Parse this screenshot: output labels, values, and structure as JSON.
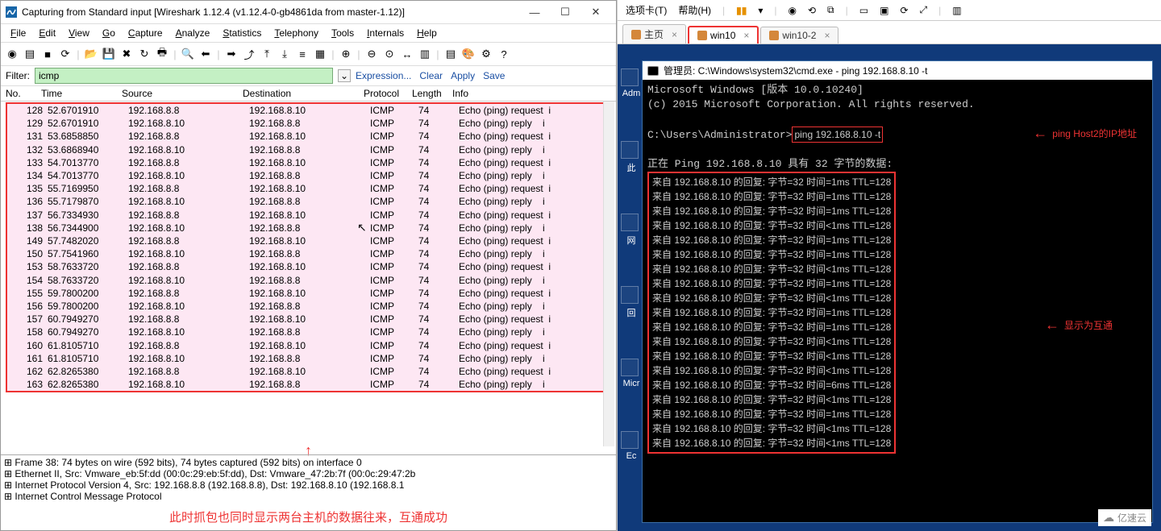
{
  "wireshark": {
    "title": "Capturing from Standard input   [Wireshark 1.12.4  (v1.12.4-0-gb4861da from master-1.12)]",
    "menu": [
      "File",
      "Edit",
      "View",
      "Go",
      "Capture",
      "Analyze",
      "Statistics",
      "Telephony",
      "Tools",
      "Internals",
      "Help"
    ],
    "toolbar_icons": [
      "record-icon",
      "list-icon",
      "stop-icon",
      "reload-icon",
      "open-icon",
      "save-icon",
      "close-icon",
      "restart-icon",
      "print-icon",
      "find-icon",
      "back-icon",
      "forward-icon",
      "jump-icon",
      "top-icon",
      "bottom-icon",
      "autoscroll-icon",
      "colorize-icon",
      "zoom-in-icon",
      "zoom-out-icon",
      "zoom-fit-icon",
      "resize-icon",
      "capture-filter-icon",
      "display-filter-icon",
      "color-rules-icon",
      "prefs-icon",
      "help-icon"
    ],
    "filter": {
      "label": "Filter:",
      "value": "icmp",
      "links": [
        "Expression...",
        "Clear",
        "Apply",
        "Save"
      ]
    },
    "columns": [
      "No.",
      "Time",
      "Source",
      "Destination",
      "Protocol",
      "Length",
      "Info"
    ],
    "rows": [
      {
        "no": "128",
        "time": "52.6701910",
        "src": "192.168.8.8",
        "dst": "192.168.8.10",
        "proto": "ICMP",
        "len": "74",
        "info": "Echo (ping) request  i"
      },
      {
        "no": "129",
        "time": "52.6701910",
        "src": "192.168.8.10",
        "dst": "192.168.8.8",
        "proto": "ICMP",
        "len": "74",
        "info": "Echo (ping) reply    i"
      },
      {
        "no": "131",
        "time": "53.6858850",
        "src": "192.168.8.8",
        "dst": "192.168.8.10",
        "proto": "ICMP",
        "len": "74",
        "info": "Echo (ping) request  i"
      },
      {
        "no": "132",
        "time": "53.6868940",
        "src": "192.168.8.10",
        "dst": "192.168.8.8",
        "proto": "ICMP",
        "len": "74",
        "info": "Echo (ping) reply    i"
      },
      {
        "no": "133",
        "time": "54.7013770",
        "src": "192.168.8.8",
        "dst": "192.168.8.10",
        "proto": "ICMP",
        "len": "74",
        "info": "Echo (ping) request  i"
      },
      {
        "no": "134",
        "time": "54.7013770",
        "src": "192.168.8.10",
        "dst": "192.168.8.8",
        "proto": "ICMP",
        "len": "74",
        "info": "Echo (ping) reply    i"
      },
      {
        "no": "135",
        "time": "55.7169950",
        "src": "192.168.8.8",
        "dst": "192.168.8.10",
        "proto": "ICMP",
        "len": "74",
        "info": "Echo (ping) request  i"
      },
      {
        "no": "136",
        "time": "55.7179870",
        "src": "192.168.8.10",
        "dst": "192.168.8.8",
        "proto": "ICMP",
        "len": "74",
        "info": "Echo (ping) reply    i"
      },
      {
        "no": "137",
        "time": "56.7334930",
        "src": "192.168.8.8",
        "dst": "192.168.8.10",
        "proto": "ICMP",
        "len": "74",
        "info": "Echo (ping) request  i"
      },
      {
        "no": "138",
        "time": "56.7344900",
        "src": "192.168.8.10",
        "dst": "192.168.8.8",
        "proto": "ICMP",
        "len": "74",
        "info": "Echo (ping) reply    i"
      },
      {
        "no": "149",
        "time": "57.7482020",
        "src": "192.168.8.8",
        "dst": "192.168.8.10",
        "proto": "ICMP",
        "len": "74",
        "info": "Echo (ping) request  i"
      },
      {
        "no": "150",
        "time": "57.7541960",
        "src": "192.168.8.10",
        "dst": "192.168.8.8",
        "proto": "ICMP",
        "len": "74",
        "info": "Echo (ping) reply    i"
      },
      {
        "no": "153",
        "time": "58.7633720",
        "src": "192.168.8.8",
        "dst": "192.168.8.10",
        "proto": "ICMP",
        "len": "74",
        "info": "Echo (ping) request  i"
      },
      {
        "no": "154",
        "time": "58.7633720",
        "src": "192.168.8.10",
        "dst": "192.168.8.8",
        "proto": "ICMP",
        "len": "74",
        "info": "Echo (ping) reply    i"
      },
      {
        "no": "155",
        "time": "59.7800200",
        "src": "192.168.8.8",
        "dst": "192.168.8.10",
        "proto": "ICMP",
        "len": "74",
        "info": "Echo (ping) request  i"
      },
      {
        "no": "156",
        "time": "59.7800200",
        "src": "192.168.8.10",
        "dst": "192.168.8.8",
        "proto": "ICMP",
        "len": "74",
        "info": "Echo (ping) reply    i"
      },
      {
        "no": "157",
        "time": "60.7949270",
        "src": "192.168.8.8",
        "dst": "192.168.8.10",
        "proto": "ICMP",
        "len": "74",
        "info": "Echo (ping) request  i"
      },
      {
        "no": "158",
        "time": "60.7949270",
        "src": "192.168.8.10",
        "dst": "192.168.8.8",
        "proto": "ICMP",
        "len": "74",
        "info": "Echo (ping) reply    i"
      },
      {
        "no": "160",
        "time": "61.8105710",
        "src": "192.168.8.8",
        "dst": "192.168.8.10",
        "proto": "ICMP",
        "len": "74",
        "info": "Echo (ping) request  i"
      },
      {
        "no": "161",
        "time": "61.8105710",
        "src": "192.168.8.10",
        "dst": "192.168.8.8",
        "proto": "ICMP",
        "len": "74",
        "info": "Echo (ping) reply    i"
      },
      {
        "no": "162",
        "time": "62.8265380",
        "src": "192.168.8.8",
        "dst": "192.168.8.10",
        "proto": "ICMP",
        "len": "74",
        "info": "Echo (ping) request  i"
      },
      {
        "no": "163",
        "time": "62.8265380",
        "src": "192.168.8.10",
        "dst": "192.168.8.8",
        "proto": "ICMP",
        "len": "74",
        "info": "Echo (ping) reply    i"
      }
    ],
    "tree": [
      "⊞ Frame 38: 74 bytes on wire (592 bits), 74 bytes captured (592 bits) on interface 0",
      "⊞ Ethernet II, Src: Vmware_eb:5f:dd (00:0c:29:eb:5f:dd), Dst: Vmware_47:2b:7f (00:0c:29:47:2b",
      "⊞ Internet Protocol Version 4, Src: 192.168.8.8 (192.168.8.8), Dst: 192.168.8.10 (192.168.8.1",
      "⊞ Internet Control Message Protocol"
    ],
    "arrow": "↑",
    "caption": "此时抓包也同时显示两台主机的数据往来，互通成功"
  },
  "vm": {
    "toolbar": {
      "tabs": "选项卡(T)",
      "help": "帮助(H)",
      "icons": [
        "pause-icon",
        "play-icon",
        "sep",
        "snapshot-icon",
        "revert-icon",
        "manage-icon",
        "sep",
        "fullscreen-icon",
        "unity-icon",
        "cycle-icon",
        "fit-icon",
        "sep",
        "console-icon"
      ]
    },
    "tabs": [
      {
        "label": "主页",
        "active": false,
        "icon": "home-icon"
      },
      {
        "label": "win10",
        "active": true,
        "icon": "vm-icon"
      },
      {
        "label": "win10-2",
        "active": false,
        "icon": "vm-icon"
      }
    ],
    "cmd": {
      "title": "管理员: C:\\Windows\\system32\\cmd.exe - ping  192.168.8.10 -t",
      "header1": "Microsoft Windows [版本 10.0.10240]",
      "header2": "(c) 2015 Microsoft Corporation. All rights reserved.",
      "prompt": "C:\\Users\\Administrator>",
      "pingcmd": "ping 192.168.8.10 -t",
      "pinging": "正在 Ping 192.168.8.10 具有 32 字节的数据:",
      "replies": [
        "来自 192.168.8.10 的回复: 字节=32 时间=1ms TTL=128",
        "来自 192.168.8.10 的回复: 字节=32 时间=1ms TTL=128",
        "来自 192.168.8.10 的回复: 字节=32 时间=1ms TTL=128",
        "来自 192.168.8.10 的回复: 字节=32 时间<1ms TTL=128",
        "来自 192.168.8.10 的回复: 字节=32 时间=1ms TTL=128",
        "来自 192.168.8.10 的回复: 字节=32 时间=1ms TTL=128",
        "来自 192.168.8.10 的回复: 字节=32 时间<1ms TTL=128",
        "来自 192.168.8.10 的回复: 字节=32 时间=1ms TTL=128",
        "来自 192.168.8.10 的回复: 字节=32 时间<1ms TTL=128",
        "来自 192.168.8.10 的回复: 字节=32 时间=1ms TTL=128",
        "来自 192.168.8.10 的回复: 字节=32 时间=1ms TTL=128",
        "来自 192.168.8.10 的回复: 字节=32 时间<1ms TTL=128",
        "来自 192.168.8.10 的回复: 字节=32 时间<1ms TTL=128",
        "来自 192.168.8.10 的回复: 字节=32 时间<1ms TTL=128",
        "来自 192.168.8.10 的回复: 字节=32 时间=6ms TTL=128",
        "来自 192.168.8.10 的回复: 字节=32 时间<1ms TTL=128",
        "来自 192.168.8.10 的回复: 字节=32 时间=1ms TTL=128",
        "来自 192.168.8.10 的回复: 字节=32 时间<1ms TTL=128",
        "来自 192.168.8.10 的回复: 字节=32 时间<1ms TTL=128"
      ]
    },
    "annot1": "ping Host2的IP地址",
    "annot2": "显示为互通",
    "sidebar_labels": [
      "Adm",
      "此",
      "网",
      "回",
      "Micr",
      "Ec"
    ]
  },
  "logo": "亿速云"
}
